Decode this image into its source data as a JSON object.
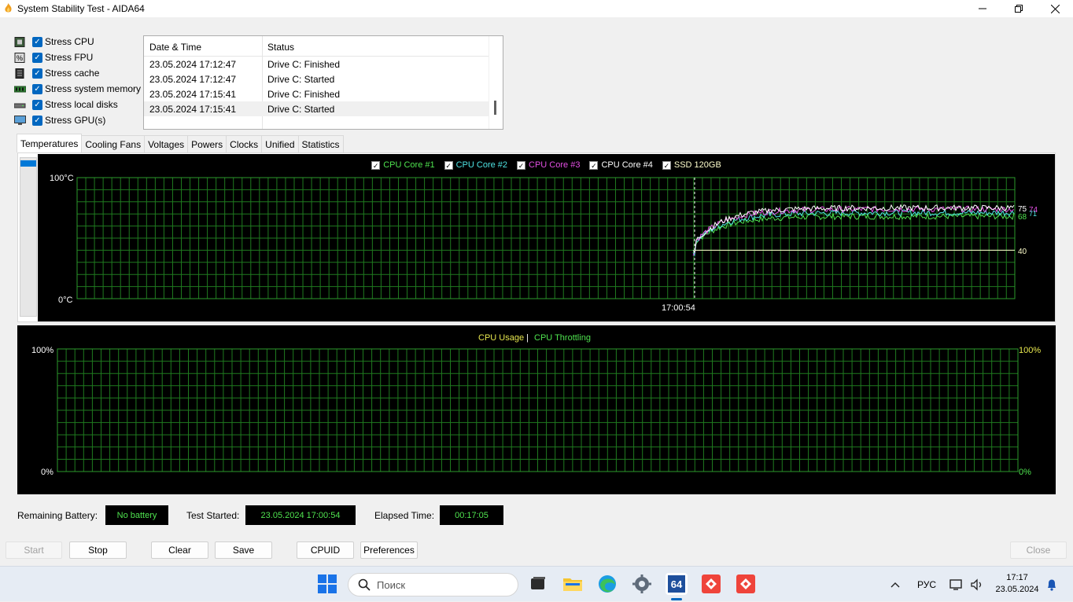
{
  "window": {
    "title": "System Stability Test - AIDA64"
  },
  "stress_options": [
    {
      "label": "Stress CPU",
      "checked": true,
      "icon": "cpu-chip-icon"
    },
    {
      "label": "Stress FPU",
      "checked": true,
      "icon": "fpu-icon"
    },
    {
      "label": "Stress cache",
      "checked": true,
      "icon": "cache-icon"
    },
    {
      "label": "Stress system memory",
      "checked": true,
      "icon": "memory-module-icon"
    },
    {
      "label": "Stress local disks",
      "checked": true,
      "icon": "disk-icon"
    },
    {
      "label": "Stress GPU(s)",
      "checked": true,
      "icon": "monitor-icon"
    }
  ],
  "log": {
    "headers": [
      "Date & Time",
      "Status"
    ],
    "rows": [
      [
        "23.05.2024 17:12:47",
        "Drive C: Finished"
      ],
      [
        "23.05.2024 17:12:47",
        "Drive C: Started"
      ],
      [
        "23.05.2024 17:15:41",
        "Drive C: Finished"
      ],
      [
        "23.05.2024 17:15:41",
        "Drive C: Started"
      ]
    ]
  },
  "tabs": [
    "Temperatures",
    "Cooling Fans",
    "Voltages",
    "Powers",
    "Clocks",
    "Unified",
    "Statistics"
  ],
  "temp_graph": {
    "legend": [
      {
        "label": "CPU Core #1",
        "color": "#4fe34f"
      },
      {
        "label": "CPU Core #2",
        "color": "#4fe3e3"
      },
      {
        "label": "CPU Core #3",
        "color": "#e34fe3"
      },
      {
        "label": "CPU Core #4",
        "color": "#ffffff"
      },
      {
        "label": "SSD 120GB",
        "color": "#ffffcc"
      }
    ],
    "y_max_label": "100°C",
    "y_min_label": "0°C",
    "marker_time": "17:00:54",
    "right_values": [
      "75",
      "74",
      "71",
      "68",
      "40"
    ]
  },
  "cpu_graph": {
    "title_usage": "CPU Usage",
    "separator": "|",
    "title_throttling": "CPU Throttling",
    "left_max": "100%",
    "left_min": "0%",
    "right_max": "100%",
    "right_min": "0%"
  },
  "status_bar": {
    "battery_label": "Remaining Battery:",
    "battery_value": "No battery",
    "started_label": "Test Started:",
    "started_value": "23.05.2024 17:00:54",
    "elapsed_label": "Elapsed Time:",
    "elapsed_value": "00:17:05"
  },
  "buttons": {
    "start": "Start",
    "stop": "Stop",
    "clear": "Clear",
    "save": "Save",
    "cpuid": "CPUID",
    "preferences": "Preferences",
    "close": "Close"
  },
  "taskbar": {
    "search_placeholder": "Поиск",
    "language": "РУС",
    "time": "17:17",
    "date": "23.05.2024",
    "aida_label": "64"
  },
  "chart_data": {
    "type": "line",
    "title": "",
    "ylabel": "",
    "ylim": [
      0,
      100
    ],
    "x_marker": "17:00:54",
    "series": [
      {
        "name": "CPU Core #1",
        "final_value": 68
      },
      {
        "name": "CPU Core #2",
        "final_value": 71
      },
      {
        "name": "CPU Core #3",
        "final_value": 74
      },
      {
        "name": "CPU Core #4",
        "final_value": 75
      },
      {
        "name": "SSD 120GB",
        "final_value": 40
      }
    ]
  }
}
